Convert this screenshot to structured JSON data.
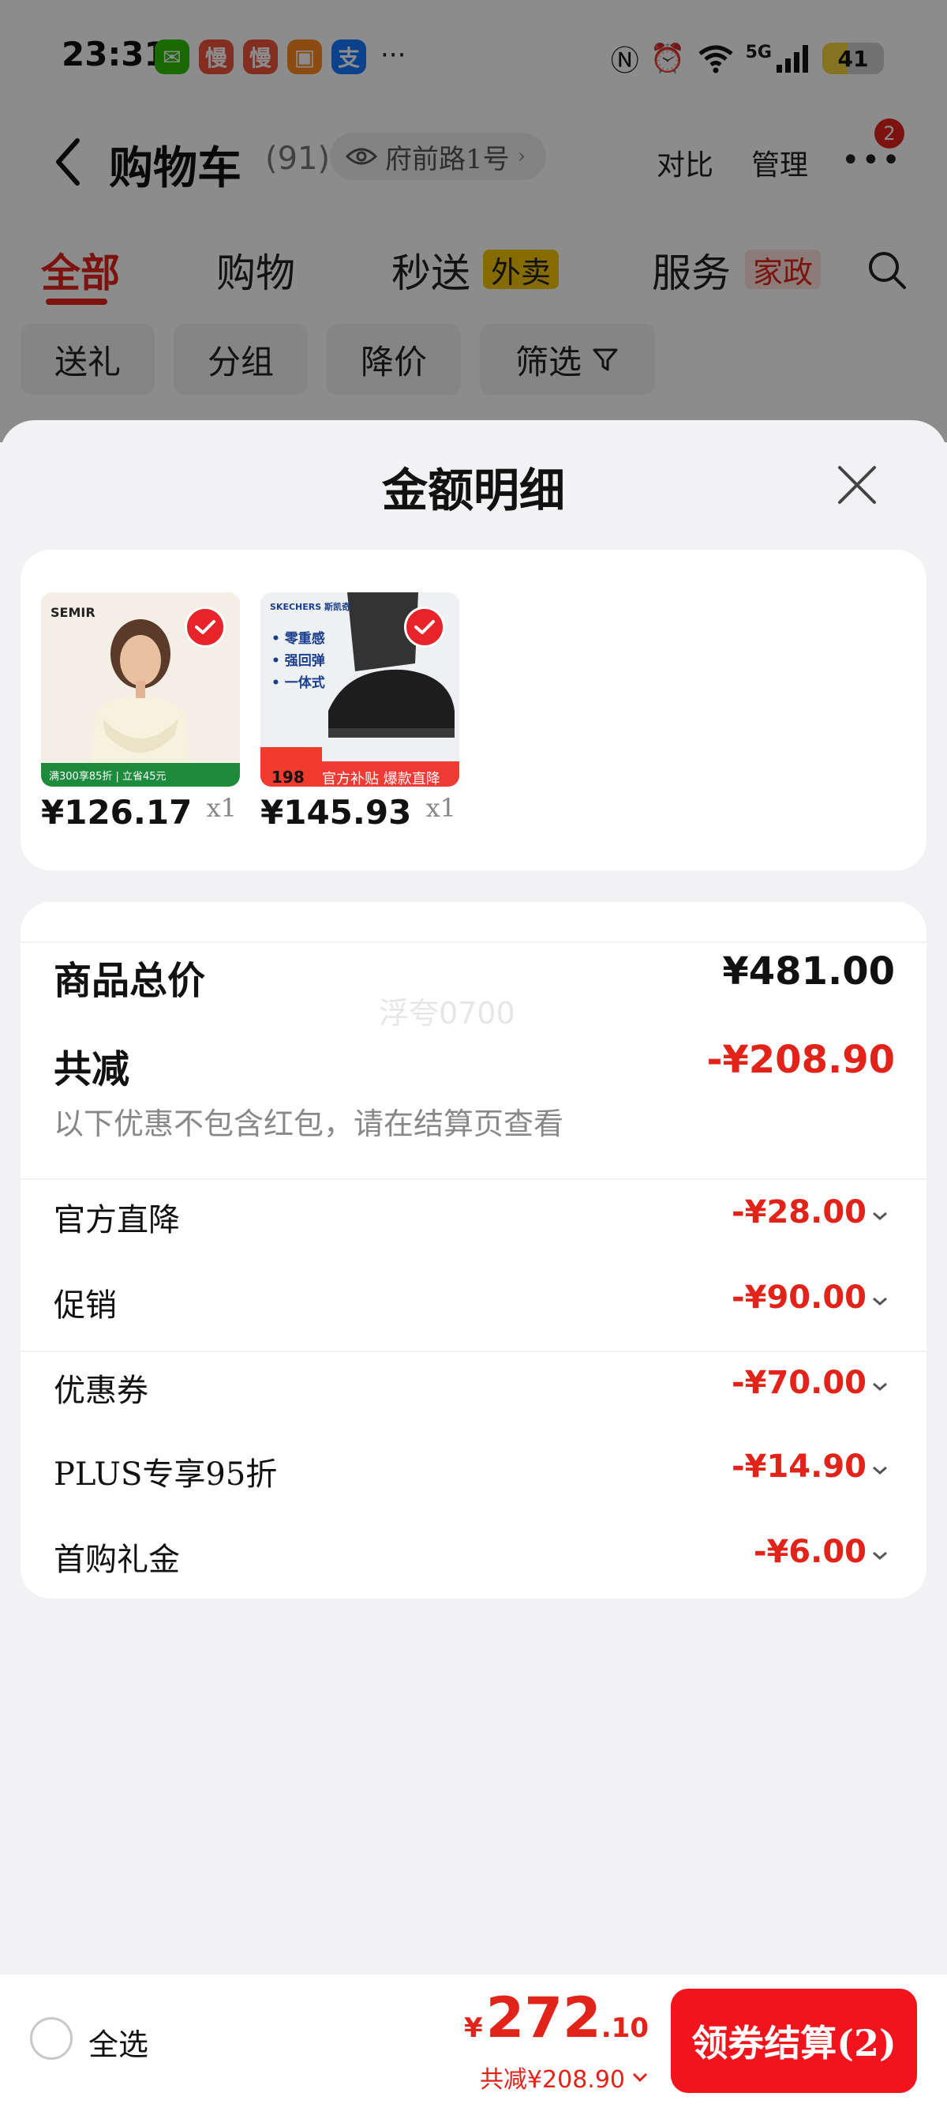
{
  "status_bar": {
    "time": "23:31",
    "apps": [
      {
        "icon": "wechat-icon",
        "glyph": "✉",
        "color": "#2dc100"
      },
      {
        "icon": "app-man-icon",
        "glyph": "慢",
        "color": "#f0523c"
      },
      {
        "icon": "app-man2-icon",
        "glyph": "慢",
        "color": "#f0523c"
      },
      {
        "icon": "redpacket-icon",
        "glyph": "▣",
        "color": "#ff8a1e"
      },
      {
        "icon": "alipay-icon",
        "glyph": "支",
        "color": "#1677ff"
      }
    ],
    "more": "···",
    "network": "5G",
    "battery": "41",
    "battery_level": 0.41
  },
  "nav": {
    "title": "购物车",
    "count": "(91)",
    "location": "府前路1号",
    "compare": "对比",
    "manage": "管理",
    "notification_badge": "2"
  },
  "tabs": [
    {
      "label": "全部",
      "active": true
    },
    {
      "label": "购物"
    },
    {
      "label": "秒送",
      "tag": "外卖",
      "tag_bg": "#f5c400",
      "tag_color": "#222"
    },
    {
      "label": "服务",
      "tag": "家政",
      "tag_bg": "#fde2df",
      "tag_color": "#e2231a"
    }
  ],
  "chips": [
    "送礼",
    "分组",
    "降价",
    "筛选"
  ],
  "sheet": {
    "title": "金额明细",
    "products": [
      {
        "price": "¥126.17",
        "qty": "x1",
        "image": "women-hoodie-product",
        "brand": "SEMIR",
        "banner": "满300享85折 | 立省45元"
      },
      {
        "price": "¥145.93",
        "qty": "x1",
        "image": "skechers-shoes-product",
        "brand": "SKECHERS 斯凯奇",
        "bullets": [
          "零重感",
          "强回弹",
          "一体式"
        ],
        "tag_price": "198",
        "banner": "官方补贴 爆款直降"
      }
    ],
    "total_label": "商品总价",
    "total_value": "¥481.00",
    "watermark": "浮夸0700",
    "reduce_label": "共减",
    "reduce_value": "-¥208.90",
    "note": "以下优惠不包含红包，请在结算页查看",
    "discounts": [
      {
        "label": "官方直降",
        "value": "-¥28.00"
      },
      {
        "label": "促销",
        "value": "-¥90.00"
      },
      {
        "label": "优惠券",
        "value": "-¥70.00"
      },
      {
        "label": "PLUS专享95折",
        "value": "-¥14.90"
      },
      {
        "label": "首购礼金",
        "value": "-¥6.00"
      }
    ]
  },
  "bottom_bar": {
    "select_all": "全选",
    "currency": "¥",
    "total_int": "272",
    "total_dec": ".10",
    "total_reduce": "共减¥208.90",
    "checkout_label": "领券结算(2)"
  },
  "colors": {
    "accent": "#e2231a",
    "checkout": "#f2141d"
  }
}
